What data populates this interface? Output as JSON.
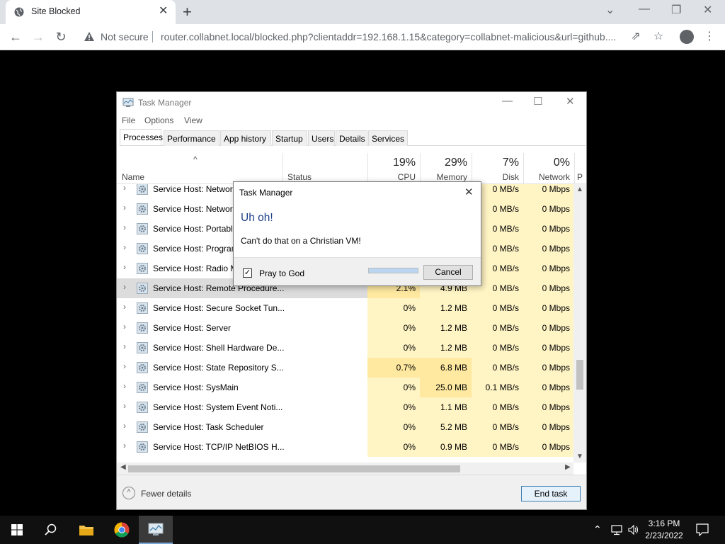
{
  "browser": {
    "tab_title": "Site Blocked",
    "security_label": "Not secure",
    "url": "router.collabnet.local/blocked.php?clientaddr=192.168.1.15&category=collabnet-malicious&url=github...."
  },
  "task_manager": {
    "title": "Task Manager",
    "menu": [
      "File",
      "Options",
      "View"
    ],
    "tabs": [
      "Processes",
      "Performance",
      "App history",
      "Startup",
      "Users",
      "Details",
      "Services"
    ],
    "header": {
      "name": "Name",
      "status": "Status",
      "cpu_pct": "19%",
      "cpu_label": "CPU",
      "mem_pct": "29%",
      "mem_label": "Memory",
      "disk_pct": "7%",
      "disk_label": "Disk",
      "net_pct": "0%",
      "net_label": "Network",
      "extra_label": "P"
    },
    "rows": [
      {
        "name": "Service Host: Network...",
        "cpu": "",
        "mem": "",
        "disk": "0 MB/s",
        "net": "0 Mbps"
      },
      {
        "name": "Service Host: Network...",
        "cpu": "",
        "mem": "",
        "disk": "0 MB/s",
        "net": "0 Mbps"
      },
      {
        "name": "Service Host: Portable...",
        "cpu": "",
        "mem": "",
        "disk": "0 MB/s",
        "net": "0 Mbps"
      },
      {
        "name": "Service Host: Program...",
        "cpu": "",
        "mem": "",
        "disk": "0 MB/s",
        "net": "0 Mbps"
      },
      {
        "name": "Service Host: Radio M...",
        "cpu": "",
        "mem": "",
        "disk": "0 MB/s",
        "net": "0 Mbps"
      },
      {
        "name": "Service Host: Remote Procedure...",
        "cpu": "2.1%",
        "mem": "4.9 MB",
        "disk": "0 MB/s",
        "net": "0 Mbps"
      },
      {
        "name": "Service Host: Secure Socket Tun...",
        "cpu": "0%",
        "mem": "1.2 MB",
        "disk": "0 MB/s",
        "net": "0 Mbps"
      },
      {
        "name": "Service Host: Server",
        "cpu": "0%",
        "mem": "1.2 MB",
        "disk": "0 MB/s",
        "net": "0 Mbps"
      },
      {
        "name": "Service Host: Shell Hardware De...",
        "cpu": "0%",
        "mem": "1.2 MB",
        "disk": "0 MB/s",
        "net": "0 Mbps"
      },
      {
        "name": "Service Host: State Repository S...",
        "cpu": "0.7%",
        "mem": "6.8 MB",
        "disk": "0 MB/s",
        "net": "0 Mbps"
      },
      {
        "name": "Service Host: SysMain",
        "cpu": "0%",
        "mem": "25.0 MB",
        "disk": "0.1 MB/s",
        "net": "0 Mbps"
      },
      {
        "name": "Service Host: System Event Noti...",
        "cpu": "0%",
        "mem": "1.1 MB",
        "disk": "0 MB/s",
        "net": "0 Mbps"
      },
      {
        "name": "Service Host: Task Scheduler",
        "cpu": "0%",
        "mem": "5.2 MB",
        "disk": "0 MB/s",
        "net": "0 Mbps"
      },
      {
        "name": "Service Host: TCP/IP NetBIOS H...",
        "cpu": "0%",
        "mem": "0.9 MB",
        "disk": "0 MB/s",
        "net": "0 Mbps"
      }
    ],
    "fewer_details": "Fewer details",
    "end_task": "End task"
  },
  "dialog": {
    "title": "Task Manager",
    "heading": "Uh oh!",
    "message": "Can't do that on a Christian VM!",
    "checkbox_label": "Pray to God",
    "checked": true,
    "progress": 1.0,
    "cancel": "Cancel"
  },
  "taskbar": {
    "time": "3:16 PM",
    "date": "2/23/2022"
  }
}
